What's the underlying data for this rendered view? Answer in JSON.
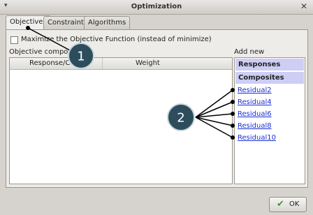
{
  "window": {
    "title": "Optimization",
    "menu_glyph": "▾",
    "close_glyph": "✕"
  },
  "tabs": [
    {
      "label": "Objectives",
      "active": true
    },
    {
      "label": "Constraints",
      "active": false
    },
    {
      "label": "Algorithms",
      "active": false
    }
  ],
  "options": {
    "maximize_label": "Maximize the Objective Function (instead of minimize)",
    "maximize_checked": false
  },
  "objectives": {
    "label": "Objective componer",
    "columns": [
      "Response/Co",
      "Weight"
    ],
    "rows": []
  },
  "add_new": {
    "label": "Add new",
    "headers": [
      "Responses",
      "Composites"
    ],
    "items": [
      "Residual2",
      "Residual4",
      "Residual6",
      "Residual8",
      "Residual10"
    ]
  },
  "buttons": {
    "ok_label": "OK",
    "ok_icon": "check-icon"
  },
  "annotations": {
    "badge1": "1",
    "badge2": "2"
  },
  "colors": {
    "link": "#1a2fd6",
    "header_bg": "#cdcdf5",
    "badge_fill": "#2e4d5c",
    "badge_stroke": "#c9d6dd"
  }
}
